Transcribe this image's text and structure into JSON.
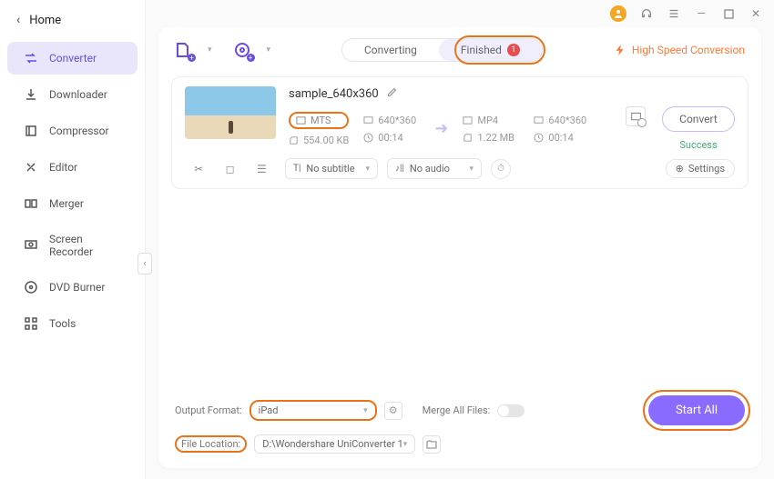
{
  "home": {
    "label": "Home"
  },
  "sidebar": {
    "items": [
      {
        "label": "Converter"
      },
      {
        "label": "Downloader"
      },
      {
        "label": "Compressor"
      },
      {
        "label": "Editor"
      },
      {
        "label": "Merger"
      },
      {
        "label": "Screen Recorder"
      },
      {
        "label": "DVD Burner"
      },
      {
        "label": "Tools"
      }
    ]
  },
  "tabs": {
    "converting": "Converting",
    "finished": "Finished",
    "badge": "1"
  },
  "speed_label": "High Speed Conversion",
  "file": {
    "name": "sample_640x360",
    "src_format": "MTS",
    "src_res": "640*360",
    "src_size": "554.00 KB",
    "src_dur": "00:14",
    "dst_format": "MP4",
    "dst_res": "640*360",
    "dst_size": "1.22 MB",
    "dst_dur": "00:14"
  },
  "convert_btn": "Convert",
  "status": "Success",
  "subtitle_sel": "No subtitle",
  "audio_sel": "No audio",
  "settings_label": "Settings",
  "output": {
    "format_label": "Output Format:",
    "format_value": "iPad",
    "location_label": "File Location:",
    "location_value": "D:\\Wondershare UniConverter 1"
  },
  "merge_label": "Merge All Files:",
  "start_all": "Start All"
}
